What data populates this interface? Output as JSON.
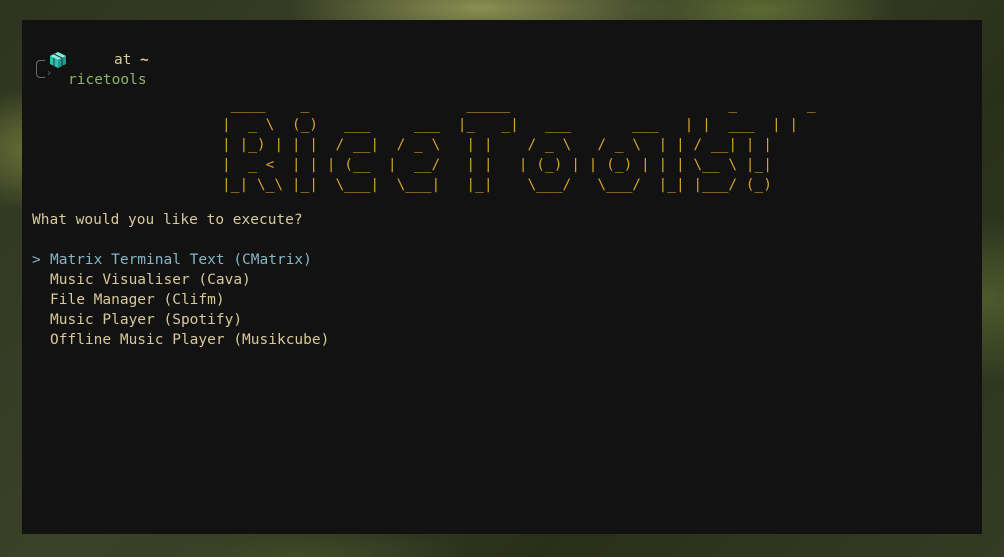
{
  "prompt": {
    "icon": "cube-icon",
    "at": "at",
    "tilde": "~",
    "directory": "ricetools"
  },
  "banner_ascii": " ____    _                  _____                         _        _\n|  _ \\  (_)   ___     ___  |_   _|   ___       ___   | |  ___  | |\n| |_) | | |  / __|  / _ \\   | |    / _ \\   / _ \\  | | / __| | |\n|  _ <  | | | (__  |  __/   | |   | (_) | | (_) | | | \\__ \\ |_|\n|_| \\_\\ |_|  \\___|  \\___|   |_|    \\___/   \\___/  |_| |___/ (_)",
  "question": "What would you like to execute?",
  "menu": {
    "marker": ">",
    "selected_index": 0,
    "items": [
      {
        "label": "Matrix Terminal Text (CMatrix)"
      },
      {
        "label": "Music Visualiser (Cava)"
      },
      {
        "label": "File Manager (Clifm)"
      },
      {
        "label": "Music Player (Spotify)"
      },
      {
        "label": "Offline Music Player (Musikcube)"
      }
    ]
  },
  "colors": {
    "terminal_bg": "#121212",
    "text": "#d7c99a",
    "directory": "#8db36a",
    "banner": "#d4a02a",
    "selected": "#84b6c6",
    "cube": "#3ad6c2"
  }
}
